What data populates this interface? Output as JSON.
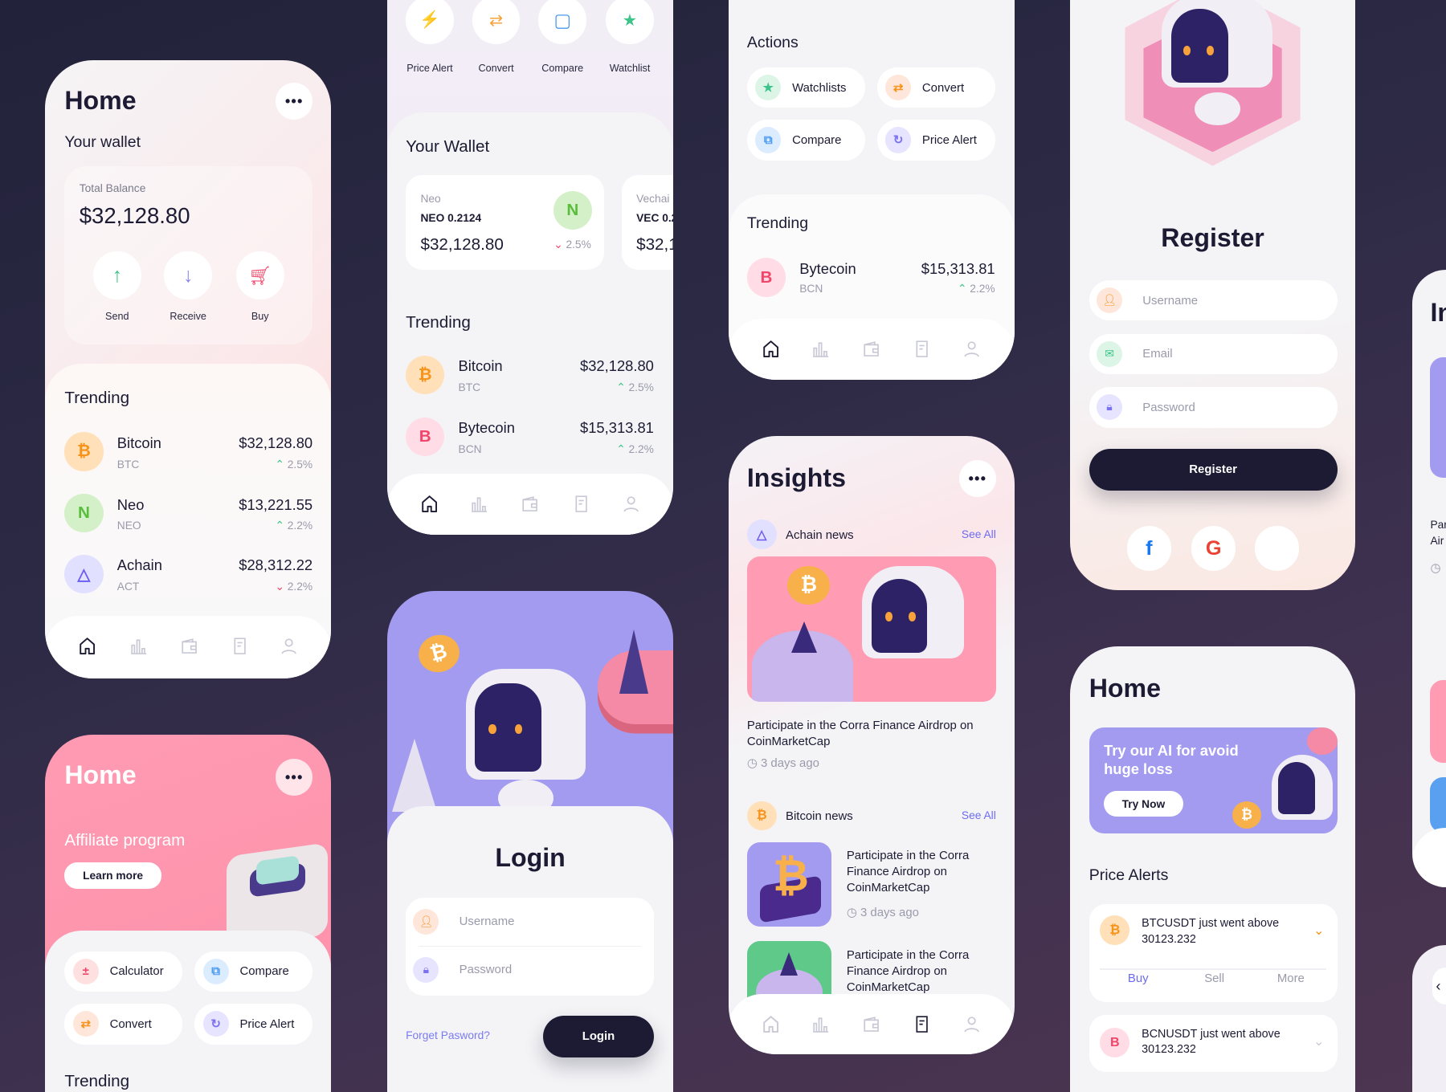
{
  "colors": {
    "background": "#2b2942",
    "accent_purple": "#a29bf0",
    "accent_pink": "#ff9bb3",
    "dark": "#1c1b33",
    "up": "#3cc48a",
    "down": "#f0466a",
    "link": "#6c6cf0"
  },
  "nav_icons": [
    "home-icon",
    "chart-icon",
    "wallet-icon",
    "document-icon",
    "user-icon"
  ],
  "wallet_home": {
    "title": "Home",
    "menu": "•••",
    "wallet_label": "Your wallet",
    "balance_label": "Total Balance",
    "balance": "$32,128.80",
    "actions": [
      {
        "label": "Send",
        "icon": "arrow-up-icon"
      },
      {
        "label": "Receive",
        "icon": "arrow-down-icon"
      },
      {
        "label": "Buy",
        "icon": "cart-icon"
      }
    ],
    "trending_title": "Trending",
    "trending": [
      {
        "name": "Bitcoin",
        "symbol": "BTC",
        "price": "$32,128.80",
        "change": "2.5%",
        "direction": "up",
        "glyph": "₿"
      },
      {
        "name": "Neo",
        "symbol": "NEO",
        "price": "$13,221.55",
        "change": "2.2%",
        "direction": "up",
        "glyph": "N"
      },
      {
        "name": "Achain",
        "symbol": "ACT",
        "price": "$28,312.22",
        "change": "2.2%",
        "direction": "down",
        "glyph": "△"
      }
    ]
  },
  "affiliate_home": {
    "title": "Home",
    "menu": "•••",
    "banner": "Affiliate program",
    "learn_more": "Learn more",
    "actions": [
      {
        "label": "Calculator",
        "glyph": "±"
      },
      {
        "label": "Compare",
        "glyph": "⧉"
      },
      {
        "label": "Convert",
        "glyph": "⇄"
      },
      {
        "label": "Price Alert",
        "glyph": "↻"
      }
    ],
    "trending_title": "Trending"
  },
  "wallet_screen": {
    "quick_actions": [
      {
        "label": "Price Alert",
        "glyph": "⚡"
      },
      {
        "label": "Convert",
        "glyph": "⇄"
      },
      {
        "label": "Compare",
        "glyph": "▢"
      },
      {
        "label": "Watchlist",
        "glyph": "★"
      }
    ],
    "wallet_title": "Your Wallet",
    "wallets": [
      {
        "name": "Neo",
        "amount": "NEO 0.2124",
        "value": "$32,128.80",
        "change": "2.5%",
        "direction": "down"
      },
      {
        "name": "Vechai",
        "amount": "VEC 0.2",
        "value": "$32,1"
      }
    ],
    "trending_title": "Trending",
    "trending": [
      {
        "name": "Bitcoin",
        "symbol": "BTC",
        "price": "$32,128.80",
        "change": "2.5%",
        "direction": "up",
        "glyph": "₿"
      },
      {
        "name": "Bytecoin",
        "symbol": "BCN",
        "price": "$15,313.81",
        "change": "2.2%",
        "direction": "up",
        "glyph": "B"
      }
    ]
  },
  "login": {
    "title": "Login",
    "username_placeholder": "Username",
    "password_placeholder": "Password",
    "forgot": "Forget Pasword?",
    "button": "Login"
  },
  "actions_screen": {
    "title": "Actions",
    "actions": [
      {
        "label": "Watchlists",
        "glyph": "★"
      },
      {
        "label": "Convert",
        "glyph": "⇄"
      },
      {
        "label": "Compare",
        "glyph": "⧉"
      },
      {
        "label": "Price Alert",
        "glyph": "↻"
      }
    ],
    "trending_title": "Trending",
    "trending": [
      {
        "name": "Bytecoin",
        "symbol": "BCN",
        "price": "$15,313.81",
        "change": "2.2%",
        "direction": "up",
        "glyph": "B"
      }
    ]
  },
  "insights": {
    "title": "Insights",
    "menu": "•••",
    "section1": {
      "name": "Achain news",
      "see_all": "See All",
      "headline": "Participate in the Corra Finance Airdrop on CoinMarketCap",
      "time": "3 days ago"
    },
    "section2": {
      "name": "Bitcoin news",
      "see_all": "See All",
      "articles": [
        {
          "headline": "Participate in the Corra Finance Airdrop on CoinMarketCap",
          "time": "3 days ago"
        },
        {
          "headline": "Participate in the Corra Finance Airdrop on CoinMarketCap"
        }
      ]
    }
  },
  "register": {
    "title": "Register",
    "username_placeholder": "Username",
    "email_placeholder": "Email",
    "password_placeholder": "Password",
    "button": "Register",
    "social": [
      "facebook-icon",
      "google-icon",
      "apple-icon"
    ]
  },
  "alerts_home": {
    "title": "Home",
    "promo": "Try our AI for avoid huge loss",
    "try_now": "Try Now",
    "alerts_title": "Price Alerts",
    "alerts": [
      {
        "text": "BTCUSDT just went above 30123.232",
        "glyph": "₿",
        "expanded": true
      },
      {
        "text": "BCNUSDT just went above 30123.232",
        "glyph": "B",
        "expanded": false
      }
    ],
    "alert_actions": [
      "Buy",
      "Sell",
      "More"
    ]
  },
  "partial_insights": {
    "title": "In",
    "headline": "Par Air"
  }
}
